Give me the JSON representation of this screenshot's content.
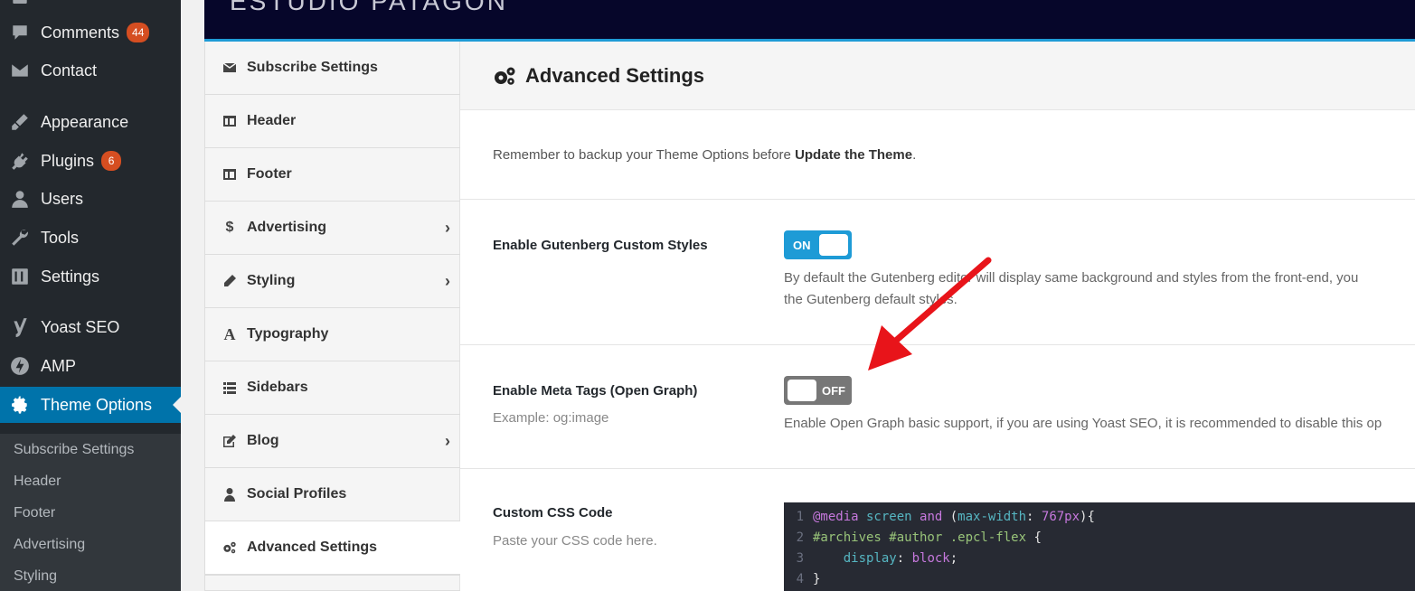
{
  "admin_menu": {
    "items": [
      {
        "label": "Comments",
        "icon": "comment-icon",
        "badge": "44"
      },
      {
        "label": "Contact",
        "icon": "envelope-icon"
      },
      {
        "label": "Appearance",
        "icon": "brush-icon"
      },
      {
        "label": "Plugins",
        "icon": "plug-icon",
        "badge": "6"
      },
      {
        "label": "Users",
        "icon": "user-icon"
      },
      {
        "label": "Tools",
        "icon": "wrench-icon"
      },
      {
        "label": "Settings",
        "icon": "sliders-icon"
      },
      {
        "label": "Yoast SEO",
        "icon": "yoast-icon"
      },
      {
        "label": "AMP",
        "icon": "amp-bolt-icon"
      },
      {
        "label": "Theme Options",
        "icon": "gear-icon",
        "current": true
      }
    ],
    "submenu": [
      "Subscribe Settings",
      "Header",
      "Footer",
      "Advertising",
      "Styling"
    ]
  },
  "banner": {
    "title": "ESTUDIO PATAGON"
  },
  "options_nav": [
    {
      "label": "Subscribe Settings",
      "icon": "envelope-icon"
    },
    {
      "label": "Header",
      "icon": "panel-icon"
    },
    {
      "label": "Footer",
      "icon": "panel-icon"
    },
    {
      "label": "Advertising",
      "icon": "dollar-icon",
      "has_children": true
    },
    {
      "label": "Styling",
      "icon": "pencil-icon",
      "has_children": true
    },
    {
      "label": "Typography",
      "icon": "font-icon"
    },
    {
      "label": "Sidebars",
      "icon": "list-icon"
    },
    {
      "label": "Blog",
      "icon": "edit-icon",
      "has_children": true
    },
    {
      "label": "Social Profiles",
      "icon": "user-icon"
    },
    {
      "label": "Advanced Settings",
      "icon": "cogs-icon",
      "active": true
    }
  ],
  "chevron": "›",
  "main": {
    "title": "Advanced Settings",
    "notice_prefix": "Remember to backup your Theme Options before ",
    "notice_bold": "Update the Theme",
    "notice_suffix": ".",
    "gutenberg": {
      "label": "Enable Gutenberg Custom Styles",
      "toggle": "ON",
      "desc_line1": "By default the Gutenberg editor will display same background and styles from the front-end, you",
      "desc_line2": "the Gutenberg default styles."
    },
    "meta_tags": {
      "label": "Enable Meta Tags (Open Graph)",
      "sub": "Example: og:image",
      "toggle": "OFF",
      "desc": "Enable Open Graph basic support, if you are using Yoast SEO, it is recommended to disable this op"
    },
    "custom_css": {
      "label": "Custom CSS Code",
      "sub": "Paste your CSS code here.",
      "lines": [
        {
          "n": "1",
          "at": "@media",
          "screen": " screen ",
          "and": "and",
          "open": " (",
          "prop": "max-width",
          "colon": ": ",
          "val": "767px",
          "close": "){"
        },
        {
          "n": "2",
          "sel": "#archives #author .epcl-flex",
          "rest": " {"
        },
        {
          "n": "3",
          "indent": "    ",
          "prop": "display",
          "colon": ": ",
          "val": "block",
          "rest": ";"
        },
        {
          "n": "4",
          "rest": "}"
        }
      ]
    }
  },
  "colors": {
    "accent": "#0073aa",
    "toggle_on": "#1e9bd6",
    "toggle_off": "#777777",
    "arrow": "#e8141a"
  }
}
